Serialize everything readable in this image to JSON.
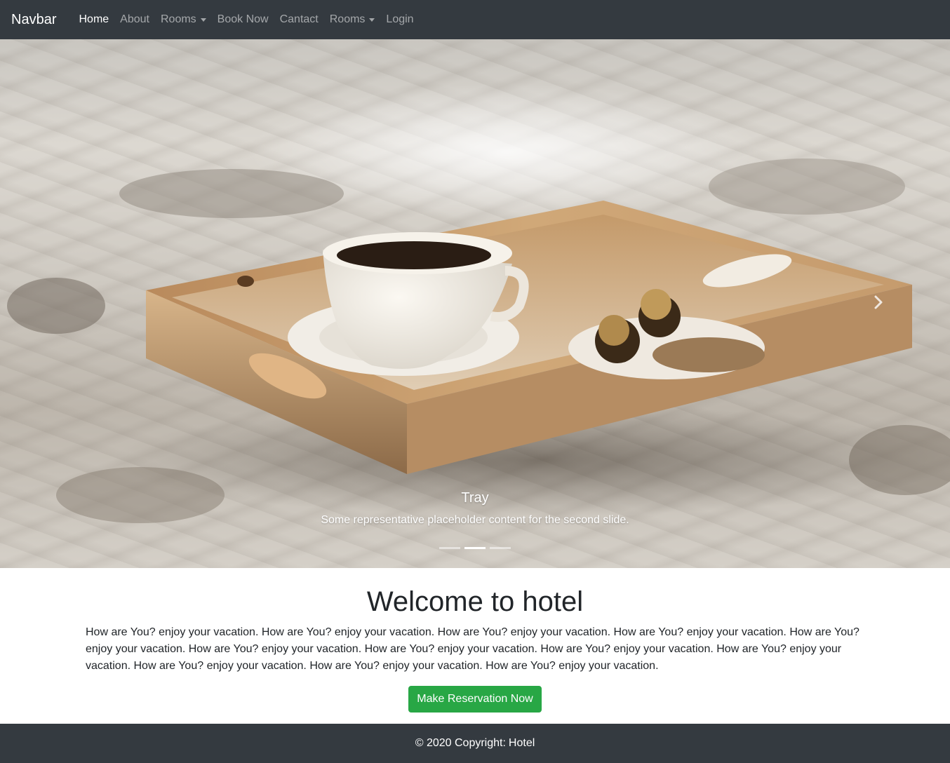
{
  "navbar": {
    "brand": "Navbar",
    "items": [
      {
        "label": "Home"
      },
      {
        "label": "About"
      },
      {
        "label": "Rooms"
      },
      {
        "label": "Book Now"
      },
      {
        "label": "Cantact"
      },
      {
        "label": "Rooms"
      },
      {
        "label": "Login"
      }
    ]
  },
  "carousel": {
    "caption_title": "Tray",
    "caption_text": "Some representative placeholder content for the second slide.",
    "active_slide": 2,
    "slide_count": 3,
    "next_icon": "chevron-right-icon"
  },
  "main": {
    "title": "Welcome to hotel",
    "text": "How are You? enjoy your vacation. How are You? enjoy your vacation. How are You? enjoy your vacation. How are You? enjoy your vacation. How are You? enjoy your vacation. How are You? enjoy your vacation. How are You? enjoy your vacation. How are You? enjoy your vacation. How are You? enjoy your vacation. How are You? enjoy your vacation. How are You? enjoy your vacation. How are You? enjoy your vacation.",
    "button_label": "Make Reservation Now"
  },
  "footer": {
    "copyright": "© 2020 Copyright:",
    "link": "Hotel"
  },
  "colors": {
    "navbar_bg": "#343a40",
    "button_green": "#28a745",
    "footer_bg": "#343a40"
  }
}
